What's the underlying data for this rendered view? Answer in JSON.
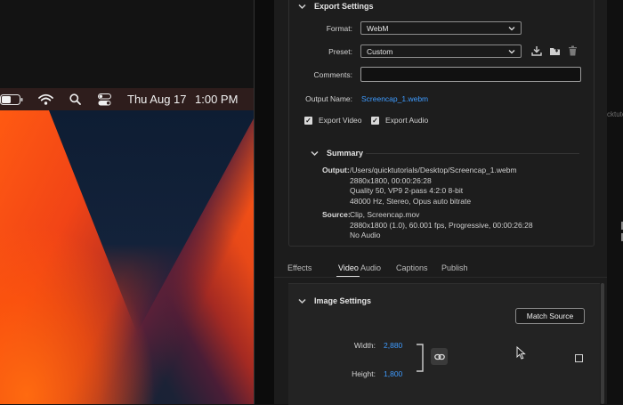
{
  "menubar": {
    "date": "Thu Aug 17",
    "time": "1:00 PM"
  },
  "export_settings": {
    "title": "Export Settings",
    "format_label": "Format:",
    "format_value": "WebM",
    "preset_label": "Preset:",
    "preset_value": "Custom",
    "comments_label": "Comments:",
    "comments_value": "",
    "output_name_label": "Output Name:",
    "output_name_value": "Screencap_1.webm",
    "export_video_label": "Export Video",
    "export_video_checked": true,
    "export_audio_label": "Export Audio",
    "export_audio_checked": true
  },
  "summary": {
    "title": "Summary",
    "output_label": "Output:",
    "output_lines": [
      "/Users/quicktutorials/Desktop/Screencap_1.webm",
      "2880x1800, 00:00:26:28",
      "Quality 50, VP9 2-pass 4:2:0 8-bit",
      "48000 Hz, Stereo, Opus auto bitrate"
    ],
    "source_label": "Source:",
    "source_lines": [
      "Clip, Screencap.mov",
      "2880x1800 (1.0), 60.001 fps, Progressive, 00:00:26:28",
      "No Audio"
    ]
  },
  "tabs": [
    "Effects",
    "Video",
    "Audio",
    "Captions",
    "Publish"
  ],
  "active_tab": "Video",
  "image_settings": {
    "title": "Image Settings",
    "match_source_label": "Match Source",
    "width_label": "Width:",
    "width_value": "2,880",
    "height_label": "Height:",
    "height_value": "1,800"
  },
  "right_edge": {
    "text": "cktuto"
  },
  "colors": {
    "accent_link": "#3e9bff",
    "menubar_bg": "#2e1d1c",
    "panel_bg": "#1c1c1c"
  },
  "icons": [
    "battery-icon",
    "wifi-icon",
    "search-icon",
    "control-center-icon",
    "download-preset-icon",
    "import-preset-icon",
    "trash-icon",
    "link-icon",
    "chevron-down-icon",
    "checkbox-icon",
    "mouse-cursor-icon"
  ]
}
